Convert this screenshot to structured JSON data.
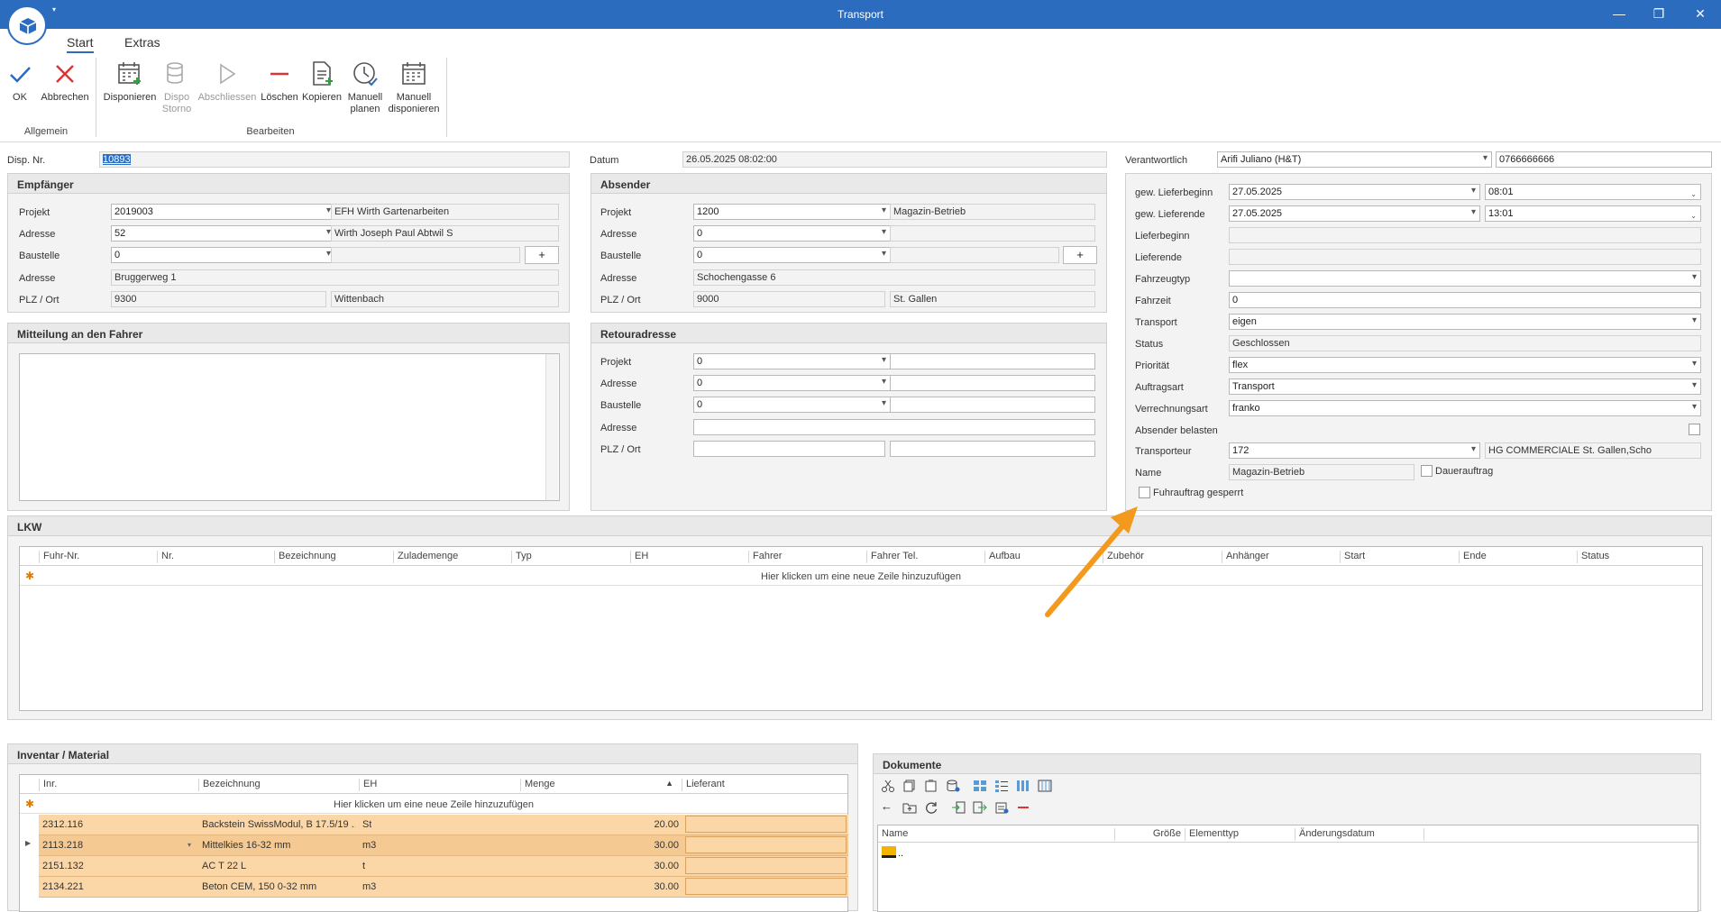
{
  "window": {
    "title": "Transport",
    "minimize": "—",
    "restore": "❐",
    "close": "✕"
  },
  "ribbon": {
    "tabs": [
      "Start",
      "Extras"
    ],
    "buttons": {
      "ok": "OK",
      "abbrechen": "Abbrechen",
      "disponieren": "Disponieren",
      "dispo_storno": [
        "Dispo",
        "Storno"
      ],
      "abschliessen": "Abschliessen",
      "loeschen": "Löschen",
      "kopieren": "Kopieren",
      "manuell_planen": [
        "Manuell",
        "planen"
      ],
      "manuell_disponieren": [
        "Manuell",
        "disponieren"
      ]
    },
    "groups": {
      "allgemein": "Allgemein",
      "bearbeiten": "Bearbeiten"
    }
  },
  "header": {
    "disp_nr_label": "Disp. Nr.",
    "disp_nr": "10893",
    "datum_label": "Datum",
    "datum": "26.05.2025 08:02:00",
    "verantwortlich_label": "Verantwortlich",
    "verantwortlich": "Arifi Juliano (H&T)",
    "phone": "0766666666"
  },
  "empfaenger": {
    "title": "Empfänger",
    "projekt_label": "Projekt",
    "projekt": "2019003",
    "projekt_name": "EFH Wirth Gartenarbeiten",
    "adresse_label": "Adresse",
    "adresse": "52",
    "adresse_name": "Wirth Joseph Paul Abtwil S",
    "baustelle_label": "Baustelle",
    "baustelle": "0",
    "baustelle_name": "",
    "plus": "+",
    "strasse_label": "Adresse",
    "strasse": "Bruggerweg 1",
    "plzort_label": "PLZ / Ort",
    "plz": "9300",
    "ort": "Wittenbach"
  },
  "absender": {
    "title": "Absender",
    "projekt_label": "Projekt",
    "projekt": "1200",
    "projekt_name": "Magazin-Betrieb",
    "adresse_label": "Adresse",
    "adresse": "0",
    "adresse_name": "",
    "baustelle_label": "Baustelle",
    "baustelle": "0",
    "baustelle_name": "",
    "plus": "+",
    "strasse_label": "Adresse",
    "strasse": "Schochengasse 6",
    "plzort_label": "PLZ / Ort",
    "plz": "9000",
    "ort": "St. Gallen"
  },
  "mitteilung": {
    "title": "Mitteilung an den Fahrer",
    "text": ""
  },
  "retour": {
    "title": "Retouradresse",
    "projekt_label": "Projekt",
    "projekt": "0",
    "adresse_label": "Adresse",
    "adresse": "0",
    "baustelle_label": "Baustelle",
    "baustelle": "0",
    "strasse_label": "Adresse",
    "plzort_label": "PLZ / Ort"
  },
  "details": {
    "lieferbeginn_gew_label": "gew. Lieferbeginn",
    "lieferbeginn_gew_date": "27.05.2025",
    "lieferbeginn_gew_time": "08:01",
    "lieferende_gew_label": "gew. Lieferende",
    "lieferende_gew_date": "27.05.2025",
    "lieferende_gew_time": "13:01",
    "lieferbeginn_label": "Lieferbeginn",
    "lieferende_label": "Lieferende",
    "fahrzeugtyp_label": "Fahrzeugtyp",
    "fahrzeit_label": "Fahrzeit",
    "fahrzeit": "0",
    "transport_label": "Transport",
    "transport": "eigen",
    "status_label": "Status",
    "status": "Geschlossen",
    "prioritaet_label": "Priorität",
    "prioritaet": "flex",
    "auftragsart_label": "Auftragsart",
    "auftragsart": "Transport",
    "verrechnungsart_label": "Verrechnungsart",
    "verrechnungsart": "franko",
    "absender_belasten_label": "Absender belasten",
    "transporteur_label": "Transporteur",
    "transporteur": "172",
    "transporteur_name": "HG COMMERCIALE St. Gallen,Scho",
    "name_label": "Name",
    "name": "Magazin-Betrieb",
    "dauerauftrag_label": "Dauerauftrag",
    "fuhrauftrag_gesperrt_label": "Fuhrauftrag gesperrt"
  },
  "lkw": {
    "title": "LKW",
    "columns": [
      "Fuhr-Nr.",
      "Nr.",
      "Bezeichnung",
      "Zulademenge",
      "Typ",
      "EH",
      "Fahrer",
      "Fahrer Tel.",
      "Aufbau",
      "Zubehör",
      "Anhänger",
      "Start",
      "Ende",
      "Status"
    ],
    "add_row": "Hier klicken um eine neue Zeile hinzuzufügen"
  },
  "inventar": {
    "title": "Inventar / Material",
    "columns": [
      "Inr.",
      "Bezeichnung",
      "EH",
      "Menge",
      "Lieferant"
    ],
    "add_row": "Hier klicken um eine neue Zeile hinzuzufügen",
    "rows": [
      {
        "inr": "2312.116",
        "bez": "Backstein SwissModul, B 17.5/19 ...",
        "eh": "St",
        "menge": "20.00"
      },
      {
        "inr": "2113.218",
        "bez": "Mittelkies 16-32 mm",
        "eh": "m3",
        "menge": "30.00"
      },
      {
        "inr": "2151.132",
        "bez": "AC T 22 L",
        "eh": "t",
        "menge": "30.00"
      },
      {
        "inr": "2134.221",
        "bez": "Beton CEM, 150  0-32 mm",
        "eh": "m3",
        "menge": "30.00"
      }
    ]
  },
  "dokumente": {
    "title": "Dokumente",
    "columns": [
      "Name",
      "Größe",
      "Elementtyp",
      "Änderungsdatum"
    ],
    "parent_item": ".."
  },
  "colors": {
    "titlebar": "#2b6cbf",
    "selection": "#fbd7a8",
    "arrow": "#f39a1e"
  }
}
